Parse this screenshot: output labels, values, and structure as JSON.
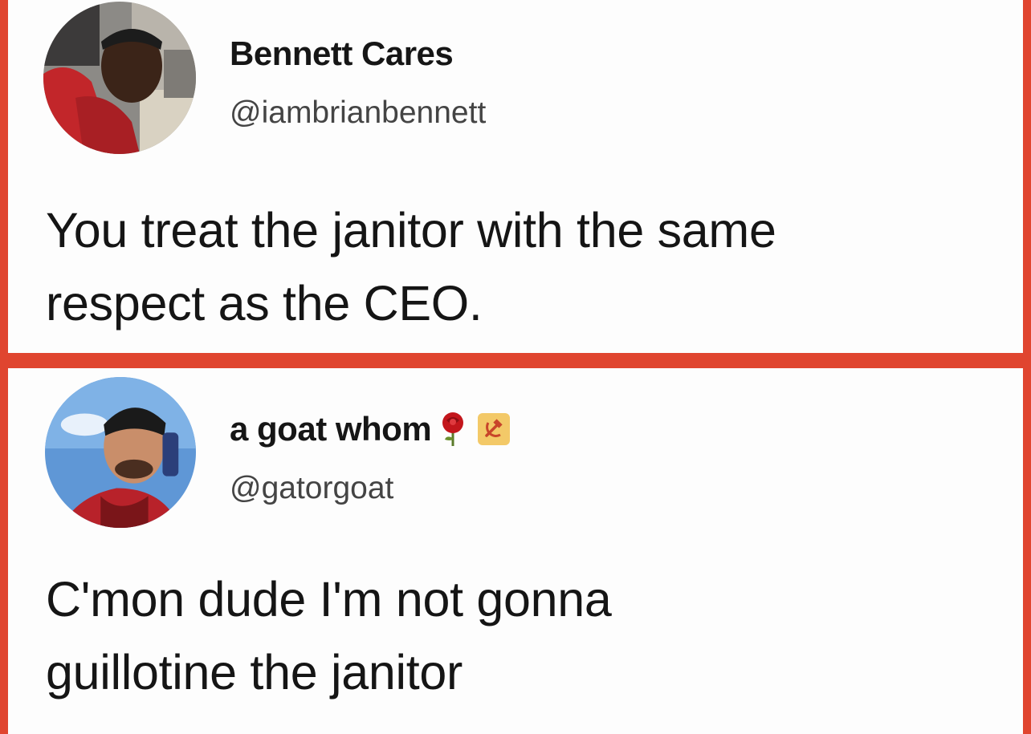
{
  "tweets": [
    {
      "display_name": "Bennett Cares",
      "handle": "@iambrianbennett",
      "text_lines": [
        "You treat the janitor with the same",
        "respect as the CEO."
      ],
      "avatar_icon": "profile-photo"
    },
    {
      "display_name": "a goat whom",
      "name_emojis": [
        "rose-icon",
        "hammer-and-sickle-icon"
      ],
      "handle": "@gatorgoat",
      "text_lines": [
        "C'mon dude I'm not gonna",
        "guillotine the janitor"
      ],
      "avatar_icon": "profile-photo"
    }
  ],
  "colors": {
    "border": "#e0452f",
    "card_background": "#fdfdfd",
    "text": "#161616",
    "handle_text": "#444444"
  }
}
